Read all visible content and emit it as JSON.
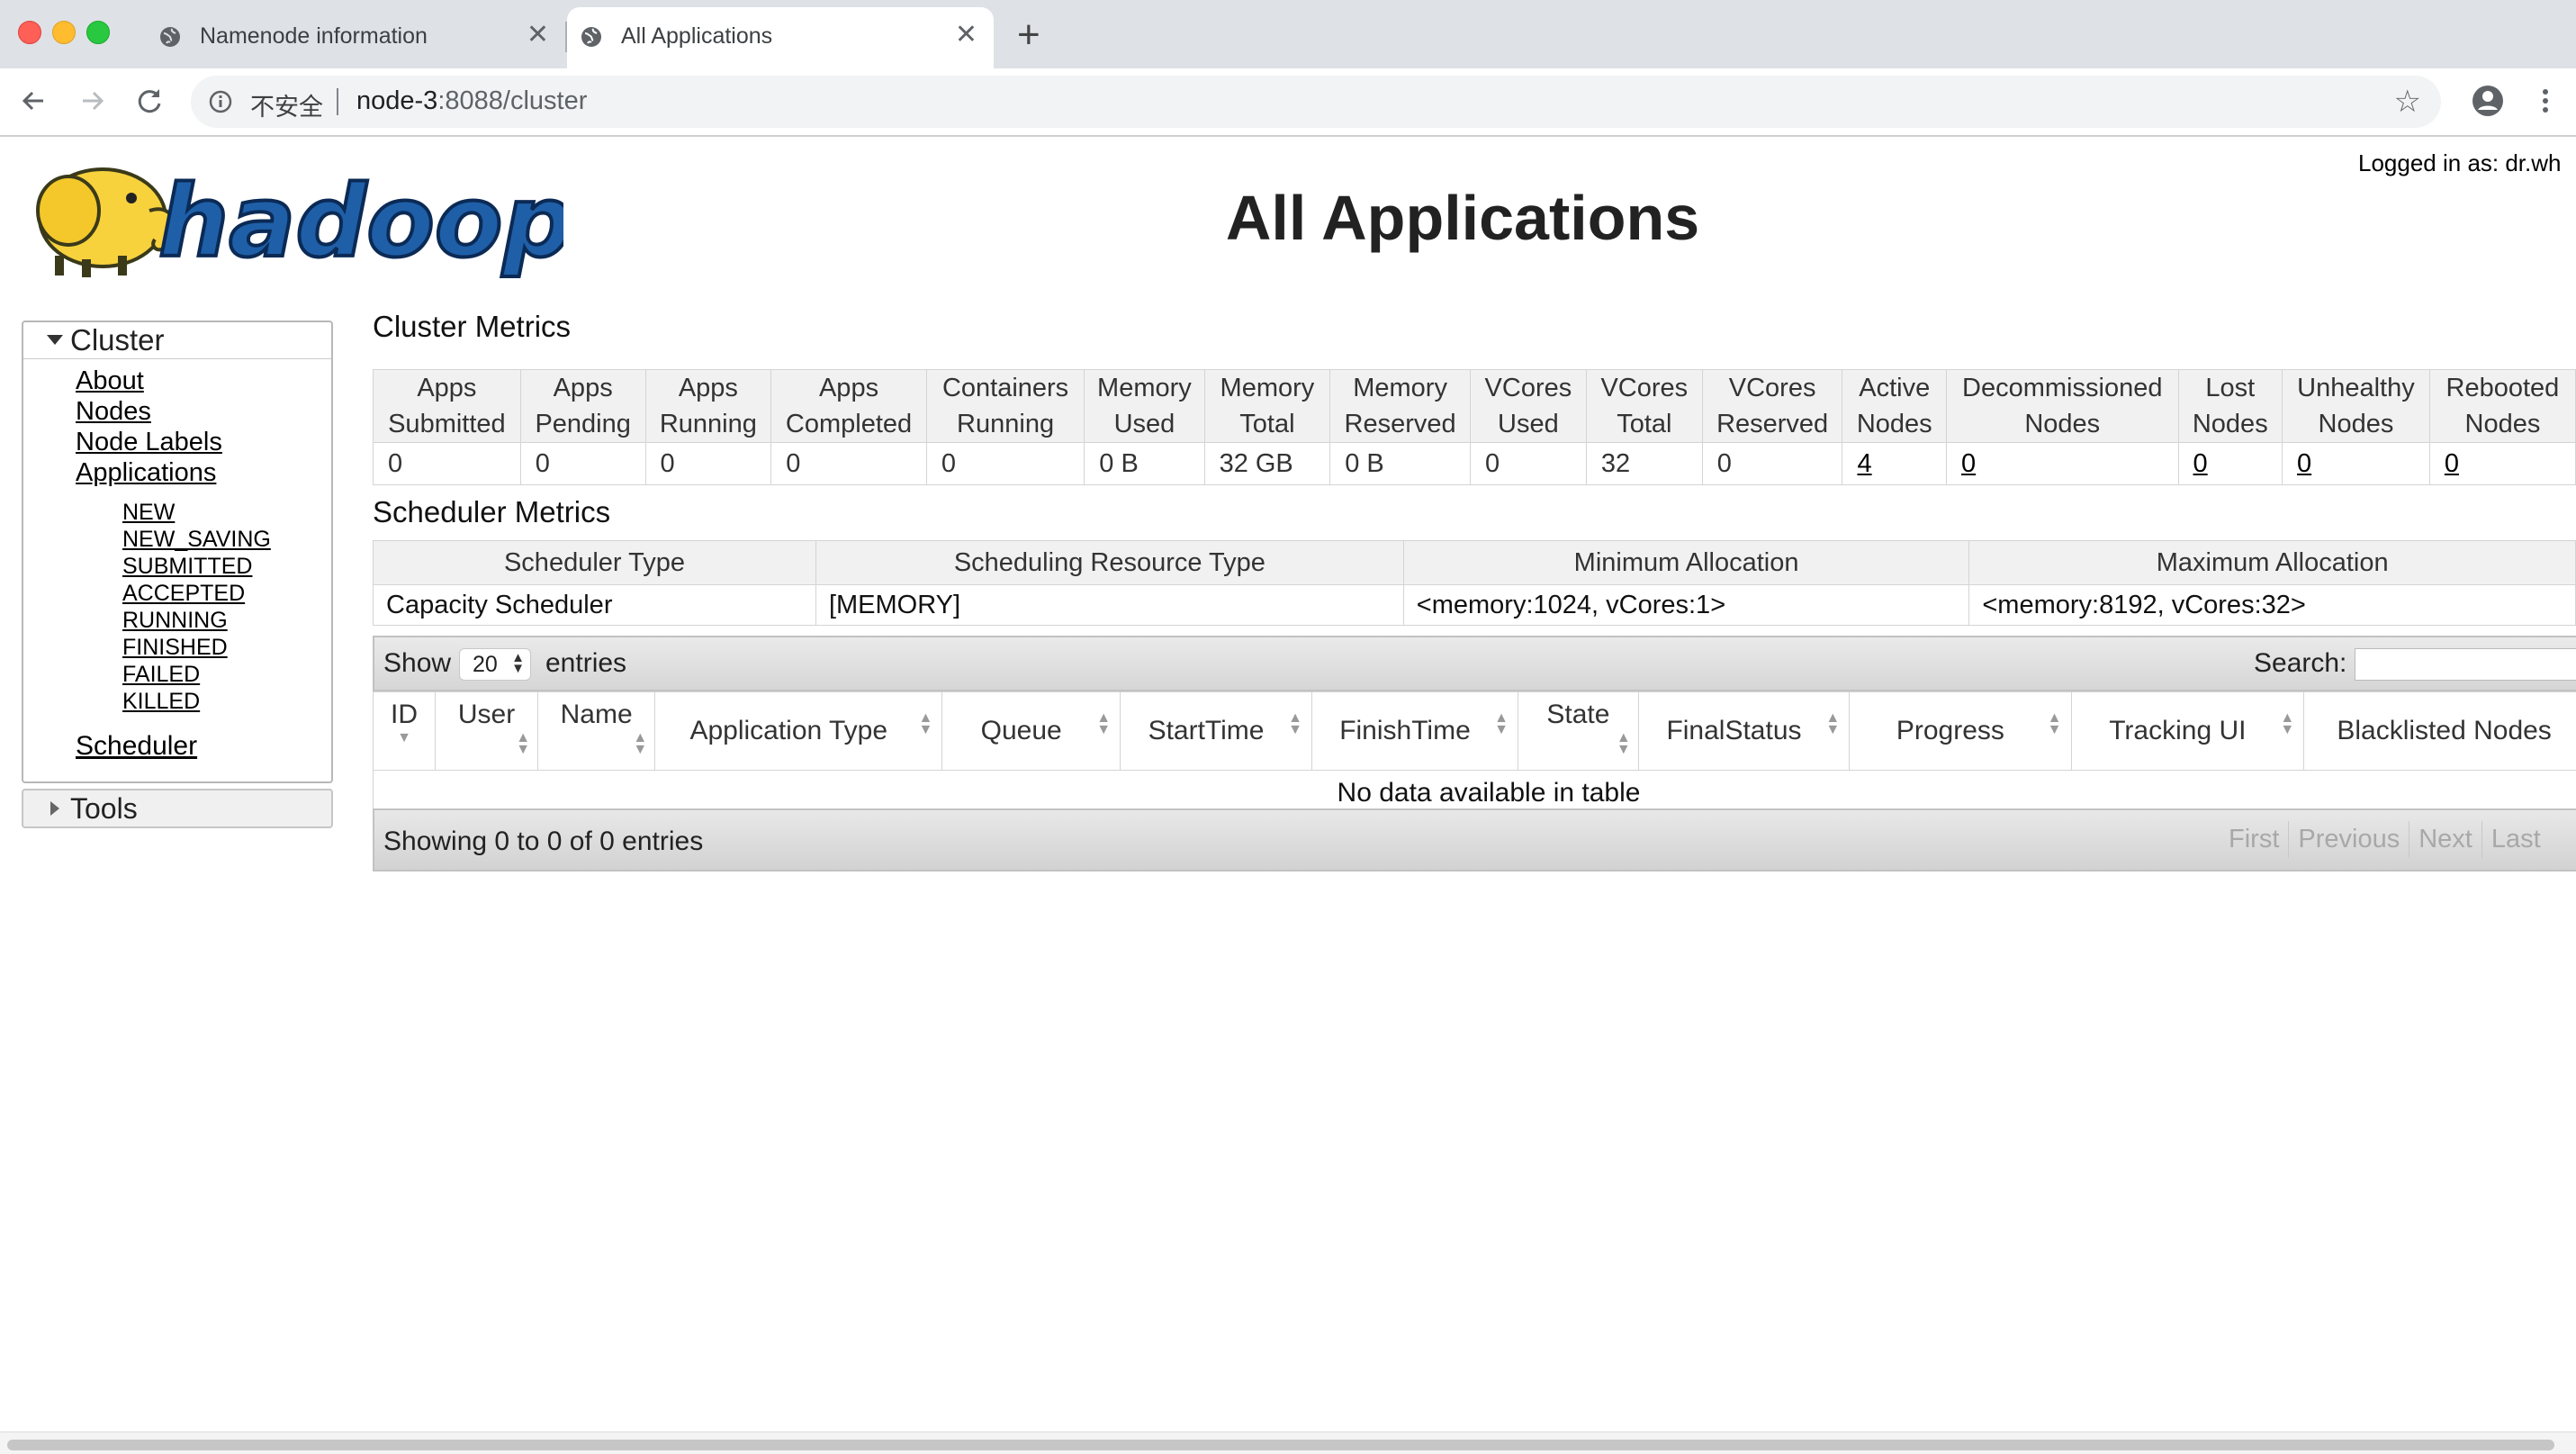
{
  "browser": {
    "tabs": [
      {
        "title": "Namenode information",
        "active": false
      },
      {
        "title": "All Applications",
        "active": true
      }
    ],
    "new_tab": "+",
    "address": {
      "security": "不安全",
      "host": "node-3",
      "path": ":8088/cluster"
    }
  },
  "header": {
    "logo_text": "hadoop",
    "title": "All Applications",
    "logged_in": "Logged in as: dr.wh"
  },
  "sidebar": {
    "cluster_label": "Cluster",
    "links": [
      "About",
      "Nodes",
      "Node Labels",
      "Applications"
    ],
    "app_states": [
      "NEW",
      "NEW_SAVING",
      "SUBMITTED",
      "ACCEPTED",
      "RUNNING",
      "FINISHED",
      "FAILED",
      "KILLED"
    ],
    "scheduler": "Scheduler",
    "tools_label": "Tools"
  },
  "cluster_metrics": {
    "title": "Cluster Metrics",
    "columns": [
      {
        "l1": "Apps",
        "l2": "Submitted",
        "value": "0",
        "link": false
      },
      {
        "l1": "Apps",
        "l2": "Pending",
        "value": "0",
        "link": false
      },
      {
        "l1": "Apps",
        "l2": "Running",
        "value": "0",
        "link": false
      },
      {
        "l1": "Apps",
        "l2": "Completed",
        "value": "0",
        "link": false
      },
      {
        "l1": "Containers",
        "l2": "Running",
        "value": "0",
        "link": false
      },
      {
        "l1": "Memory",
        "l2": "Used",
        "value": "0 B",
        "link": false
      },
      {
        "l1": "Memory",
        "l2": "Total",
        "value": "32 GB",
        "link": false
      },
      {
        "l1": "Memory",
        "l2": "Reserved",
        "value": "0 B",
        "link": false
      },
      {
        "l1": "VCores",
        "l2": "Used",
        "value": "0",
        "link": false
      },
      {
        "l1": "VCores",
        "l2": "Total",
        "value": "32",
        "link": false
      },
      {
        "l1": "VCores",
        "l2": "Reserved",
        "value": "0",
        "link": false
      },
      {
        "l1": "Active",
        "l2": "Nodes",
        "value": "4",
        "link": true
      },
      {
        "l1": "Decommissioned",
        "l2": "Nodes",
        "value": "0",
        "link": true
      },
      {
        "l1": "Lost",
        "l2": "Nodes",
        "value": "0",
        "link": true
      },
      {
        "l1": "Unhealthy",
        "l2": "Nodes",
        "value": "0",
        "link": true
      },
      {
        "l1": "Rebooted",
        "l2": "Nodes",
        "value": "0",
        "link": true
      }
    ]
  },
  "scheduler_metrics": {
    "title": "Scheduler Metrics",
    "headers": [
      "Scheduler Type",
      "Scheduling Resource Type",
      "Minimum Allocation",
      "Maximum Allocation"
    ],
    "row": [
      "Capacity Scheduler",
      "[MEMORY]",
      "<memory:1024, vCores:1>",
      "<memory:8192, vCores:32>"
    ]
  },
  "applications": {
    "show_label": "Show",
    "page_size": "20",
    "entries_label": "entries",
    "search_label": "Search:",
    "columns": [
      "ID",
      "User",
      "Name",
      "Application Type",
      "Queue",
      "StartTime",
      "FinishTime",
      "State",
      "FinalStatus",
      "Progress",
      "Tracking UI",
      "Blacklisted Nodes"
    ],
    "empty_message": "No data available in table",
    "summary": "Showing 0 to 0 of 0 entries",
    "pager": [
      "First",
      "Previous",
      "Next",
      "Last"
    ]
  },
  "colors": {
    "logo_blue": "#1e5fa8",
    "elephant_yellow": "#f7d23d"
  }
}
